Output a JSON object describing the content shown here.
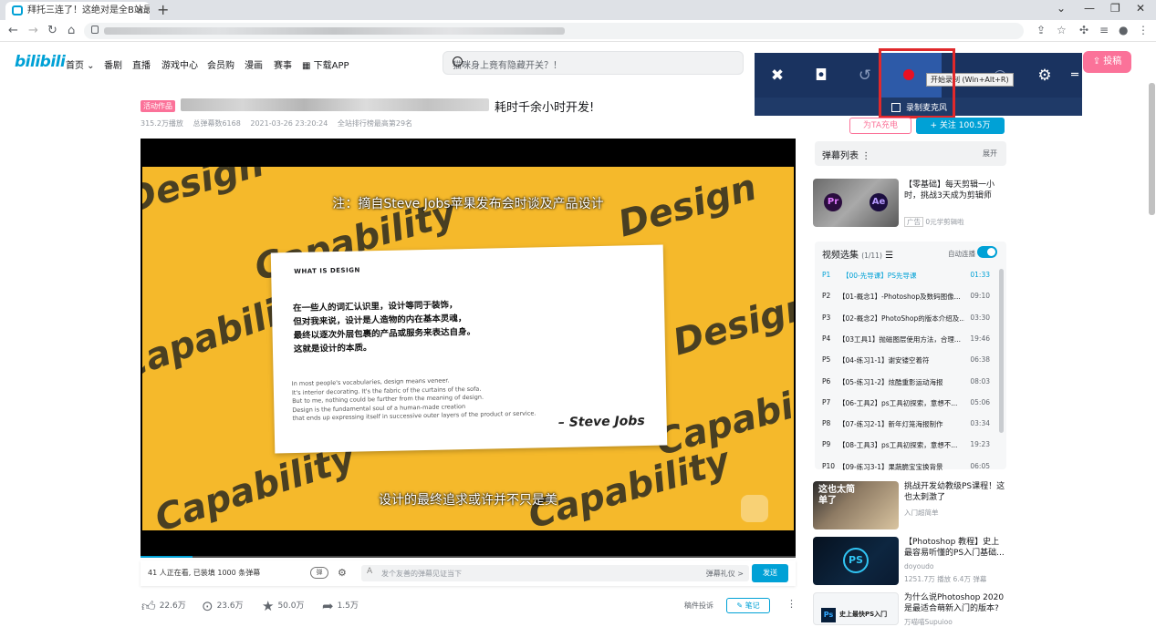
{
  "browser": {
    "tab_title": "拜托三连了！这绝对是全B站最用",
    "new_tab": "+",
    "controls": [
      "⌄",
      "—",
      "❐",
      "✕"
    ]
  },
  "header": {
    "logo": "bilibili",
    "nav": [
      "首页",
      "番剧",
      "直播",
      "游戏中心",
      "会员购",
      "漫画",
      "赛事",
      "下载APP"
    ],
    "search_placeholder": "猫咪身上竟有隐藏开关？！",
    "upload": "投稿"
  },
  "xbox": {
    "record_tooltip": "开始录制 (Win+Alt+R)",
    "mic_label": "录制麦克风",
    "highlight_color": "#e0292b"
  },
  "video": {
    "tag": "活动作品",
    "title_visible": "耗时千余小时开发!",
    "meta": [
      "315.2万播放",
      "总弹幕数6168",
      "2021-03-26 23:20:24",
      "全站排行榜最高第29名"
    ],
    "subtitle_top": "注：摘自Steve Jobs苹果发布会时谈及产品设计",
    "subtitle_bottom": "设计的最终追求或许并不只是美",
    "card_heading": "WHAT IS DESIGN",
    "card_zh": [
      "在一些人的词汇认识里，设计等同于装饰，",
      "但对我来说，设计是人造物的内在基本灵魂，",
      "最终以逐次外层包裹的产品或服务来表达自身。",
      "这就是设计的本质。"
    ],
    "card_en": [
      "In most people's vocabularies, design means veneer.",
      "It's interior decorating. It's the fabric of the curtains of the sofa.",
      "But to me, nothing could be further from the meaning of design.",
      "Design is the fundamental soul of a human-made creation",
      "that ends up expressing itself in successive outer layers of the product or service."
    ],
    "card_sig": "– Steve Jobs",
    "bg_words": [
      "Design",
      "Capability",
      "Design",
      "Capability",
      "Design"
    ],
    "progress": 0.08
  },
  "danmaku": {
    "count_text": "41 人正在看, 已装填 1000 条弹幕",
    "toggle": "弹",
    "input_placeholder": "发个友善的弹幕见证当下",
    "etiquette": "弹幕礼仪 >",
    "send": "发送"
  },
  "actions": {
    "like": "22.6万",
    "coin": "23.6万",
    "fav": "50.0万",
    "share": "1.5万",
    "report": "稿件投诉",
    "note": "笔记"
  },
  "sidebar": {
    "charge": "为TA充电",
    "follow": "关注 100.5万",
    "danmaku_list": "弹幕列表",
    "expand": "展开",
    "ad_title": "【零基础】每天剪辑一小时，挑战3天成为剪辑师",
    "ad_tag": "广告",
    "ad_author": "0元学剪辑啦",
    "playlist_title": "视频选集",
    "playlist_count": "(1/11)",
    "autoplay": "自动连播",
    "episodes": [
      {
        "p": "P1",
        "name": "【00-先导课】PS先导课",
        "dur": "01:33"
      },
      {
        "p": "P2",
        "name": "【01-概念1】-Photoshop及数码图像...",
        "dur": "09:10"
      },
      {
        "p": "P3",
        "name": "【02-概念2】PhotoShop的版本介绍及...",
        "dur": "03:30"
      },
      {
        "p": "P4",
        "name": "【03工具1】抛磁图层使用方法，合理...",
        "dur": "19:46"
      },
      {
        "p": "P5",
        "name": "【04-练习1-1】谢安镂空着符",
        "dur": "06:38"
      },
      {
        "p": "P6",
        "name": "【05-练习1-2】炫酷重影运动海报",
        "dur": "08:03"
      },
      {
        "p": "P7",
        "name": "【06-工具2】ps工具初探索，意想不...",
        "dur": "05:06"
      },
      {
        "p": "P8",
        "name": "【07-练习2-1】新年灯笼海报制作",
        "dur": "03:34"
      },
      {
        "p": "P9",
        "name": "【08-工具3】ps工具初探索，意想不...",
        "dur": "19:23"
      },
      {
        "p": "P10",
        "name": "【09-练习3-1】果蔬脆宝宝换背景",
        "dur": "06:05"
      }
    ],
    "recs": [
      {
        "title": "挑战开发幼教级PS课程！这也太刺激了",
        "author": "入门超简单",
        "stats": "",
        "thumb_text": "这也太简单了"
      },
      {
        "title": "【Photoshop 教程】史上最容易听懂的PS入门基础...",
        "author": "doyoudo",
        "stats": "1251.7万 播放   6.4万 弹幕",
        "thumb_text": "PS"
      },
      {
        "title": "为什么说Photoshop 2020是最适合萌新入门的版本?",
        "author": "万喵喵Supuioo",
        "stats": "",
        "thumb_text": "史上最快PS入门"
      }
    ]
  }
}
